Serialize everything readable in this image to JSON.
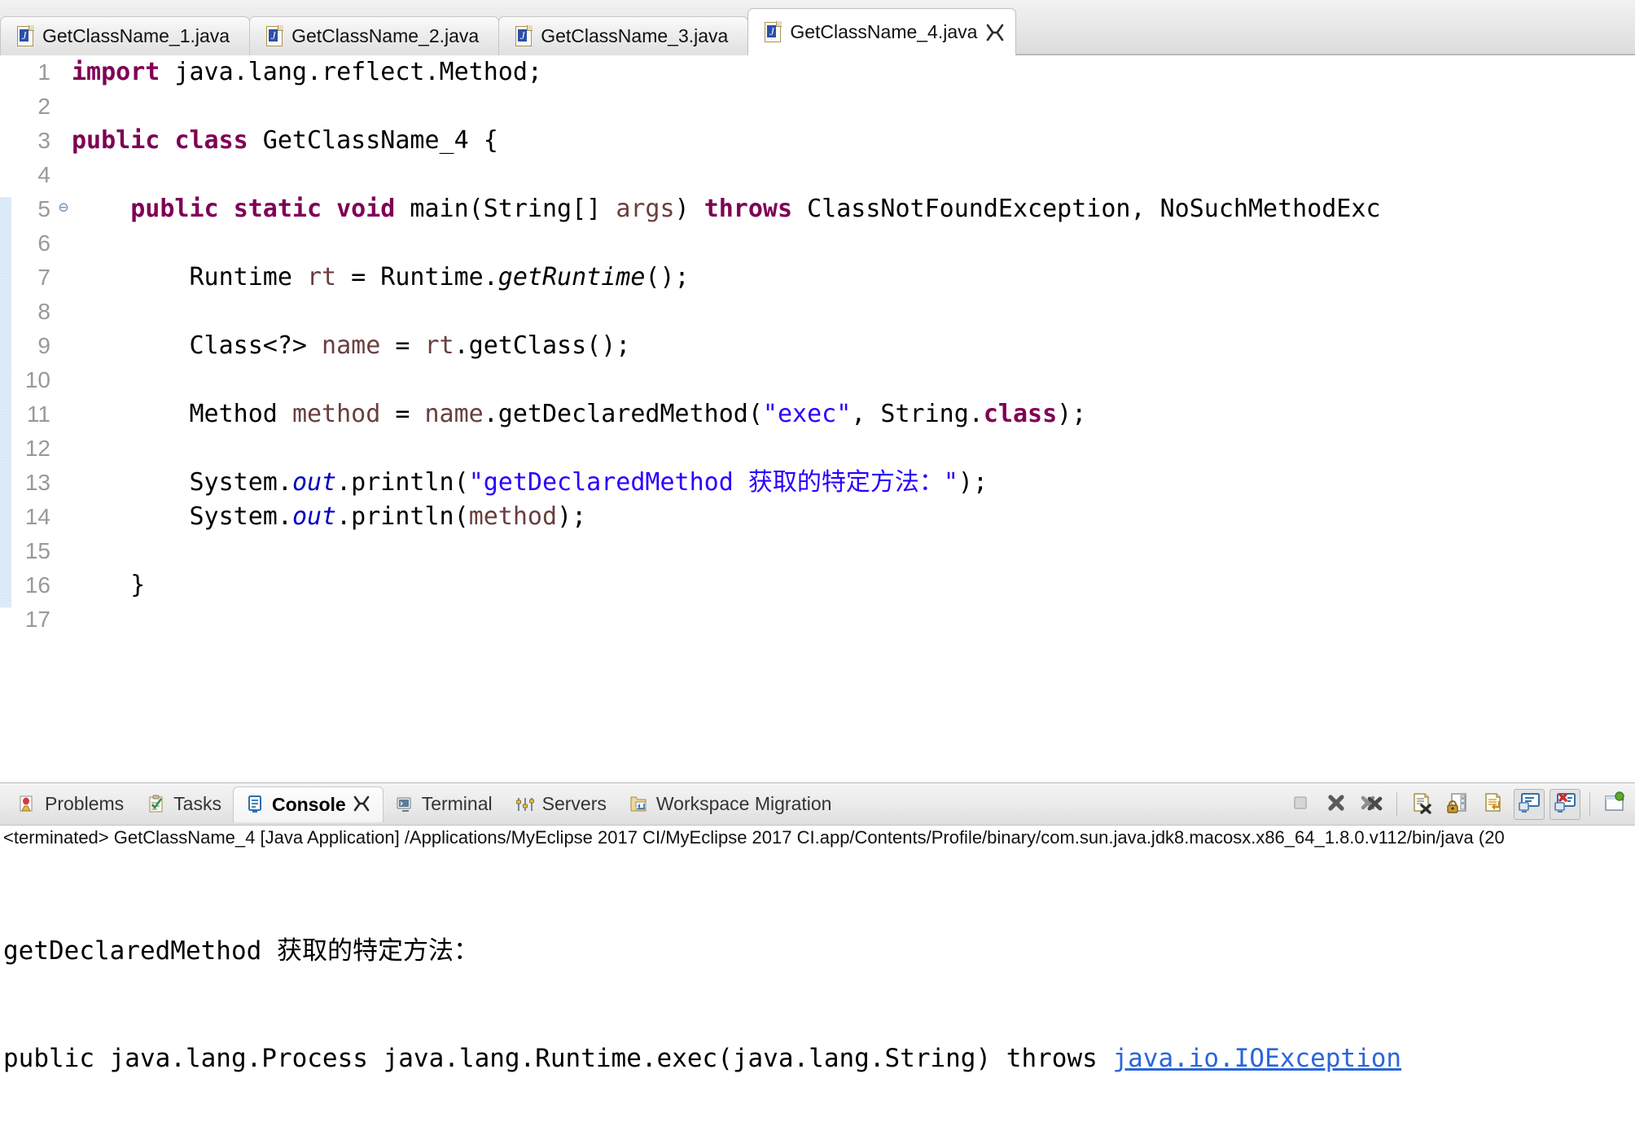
{
  "editor_tabs": [
    {
      "label": "GetClassName_1.java",
      "icon": "java-file-icon",
      "active": false
    },
    {
      "label": "GetClassName_2.java",
      "icon": "java-file-icon",
      "active": false
    },
    {
      "label": "GetClassName_3.java",
      "icon": "java-file-icon",
      "active": false
    },
    {
      "label": "GetClassName_4.java",
      "icon": "java-file-icon",
      "active": true,
      "close_icon": "close-icon"
    }
  ],
  "code_lines": [
    {
      "n": "1",
      "fold": false,
      "highlight": false,
      "html": "<span class=\"kw\">import</span> java.lang.reflect.Method;"
    },
    {
      "n": "2",
      "fold": false,
      "highlight": false,
      "html": ""
    },
    {
      "n": "3",
      "fold": false,
      "highlight": false,
      "html": "<span class=\"kw\">public</span> <span class=\"kw\">class</span> GetClassName_4 {"
    },
    {
      "n": "4",
      "fold": false,
      "highlight": false,
      "html": ""
    },
    {
      "n": "5",
      "fold": true,
      "highlight": true,
      "html": "    <span class=\"kw\">public</span> <span class=\"kw\">static</span> <span class=\"kw\">void</span> main(String[] <span class=\"var\">args</span>) <span class=\"kw\">throws</span> ClassNotFoundException, NoSuchMethodExc"
    },
    {
      "n": "6",
      "fold": false,
      "highlight": true,
      "html": ""
    },
    {
      "n": "7",
      "fold": false,
      "highlight": true,
      "html": "        Runtime <span class=\"var\">rt</span> = Runtime.<span class=\"smth\">getRuntime</span>();"
    },
    {
      "n": "8",
      "fold": false,
      "highlight": true,
      "html": ""
    },
    {
      "n": "9",
      "fold": false,
      "highlight": true,
      "html": "        Class&lt;?&gt; <span class=\"var\">name</span> = <span class=\"var\">rt</span>.getClass();"
    },
    {
      "n": "10",
      "fold": false,
      "highlight": true,
      "html": ""
    },
    {
      "n": "11",
      "fold": false,
      "highlight": true,
      "html": "        Method <span class=\"var\">method</span> = <span class=\"var\">name</span>.getDeclaredMethod(<span class=\"str\">\"exec\"</span>, String.<span class=\"kw\">class</span>);"
    },
    {
      "n": "12",
      "fold": false,
      "highlight": true,
      "html": ""
    },
    {
      "n": "13",
      "fold": false,
      "highlight": true,
      "html": "        System.<span class=\"sfld\">out</span>.println(<span class=\"str\">\"getDeclaredMethod 获取的特定方法：\"</span>);"
    },
    {
      "n": "14",
      "fold": false,
      "highlight": true,
      "html": "        System.<span class=\"sfld\">out</span>.println(<span class=\"var\">method</span>);"
    },
    {
      "n": "15",
      "fold": false,
      "highlight": true,
      "html": ""
    },
    {
      "n": "16",
      "fold": false,
      "highlight": true,
      "html": "    }"
    },
    {
      "n": "17",
      "fold": false,
      "highlight": false,
      "html": ""
    }
  ],
  "view_tabs": [
    {
      "label": "Problems",
      "icon": "problems-icon",
      "active": false
    },
    {
      "label": "Tasks",
      "icon": "tasks-icon",
      "active": false
    },
    {
      "label": "Console",
      "icon": "console-icon",
      "active": true,
      "close_icon": "close-icon"
    },
    {
      "label": "Terminal",
      "icon": "terminal-icon",
      "active": false
    },
    {
      "label": "Servers",
      "icon": "servers-icon",
      "active": false
    },
    {
      "label": "Workspace Migration",
      "icon": "migration-icon",
      "active": false
    }
  ],
  "console_toolbar": [
    {
      "name": "terminate-button",
      "icon": "stop-square-icon",
      "toggled": false,
      "disabled": true
    },
    {
      "name": "remove-launch-button",
      "icon": "x-icon",
      "toggled": false,
      "disabled": false
    },
    {
      "name": "remove-all-terminated-button",
      "icon": "double-x-icon",
      "toggled": false,
      "disabled": false
    },
    {
      "name": "separator-1",
      "icon": "separator",
      "toggled": false,
      "disabled": false
    },
    {
      "name": "clear-console-button",
      "icon": "clear-console-icon",
      "toggled": false,
      "disabled": false
    },
    {
      "name": "scroll-lock-button",
      "icon": "scroll-lock-icon",
      "toggled": false,
      "disabled": false
    },
    {
      "name": "word-wrap-button",
      "icon": "word-wrap-icon",
      "toggled": false,
      "disabled": false
    },
    {
      "name": "show-console-on-output-button",
      "icon": "console-output-icon",
      "toggled": true,
      "disabled": false
    },
    {
      "name": "show-console-on-error-button",
      "icon": "console-error-icon",
      "toggled": true,
      "disabled": false
    },
    {
      "name": "separator-2",
      "icon": "separator",
      "toggled": false,
      "disabled": false
    },
    {
      "name": "pin-console-button",
      "icon": "pin-icon",
      "toggled": false,
      "disabled": false
    }
  ],
  "console": {
    "status_line": "<terminated> GetClassName_4 [Java Application] /Applications/MyEclipse 2017 CI/MyEclipse 2017 CI.app/Contents/Profile/binary/com.sun.java.jdk8.macosx.x86_64_1.8.0.v112/bin/java (20",
    "output_line_1": "getDeclaredMethod 获取的特定方法：",
    "output_line_2_pre": "public java.lang.Process java.lang.Runtime.exec(java.lang.String) throws ",
    "output_line_2_link": "java.io.IOException"
  },
  "colors": {
    "keyword": "#7f0055",
    "string": "#2a00ff",
    "local_var": "#6a3e3e",
    "static_field": "#0000c0",
    "link": "#2a66d9",
    "line_number": "#999999",
    "highlight_bar": "#cfe3f7"
  }
}
